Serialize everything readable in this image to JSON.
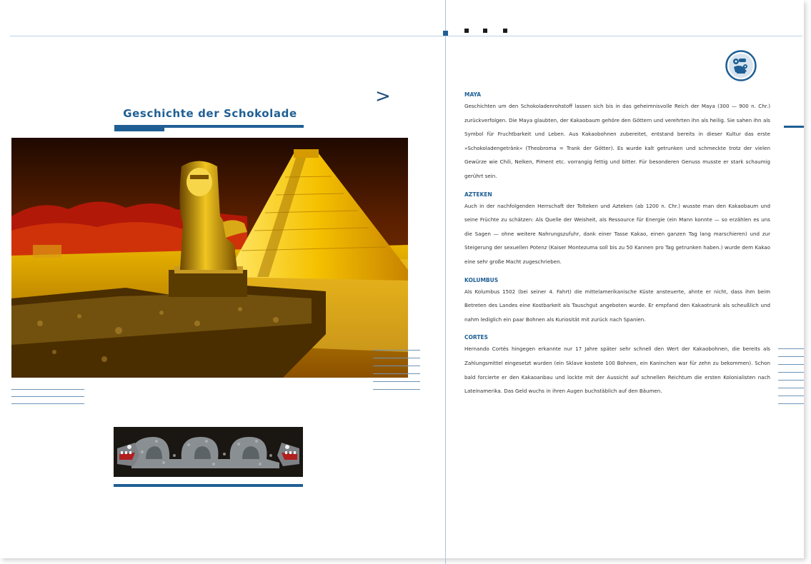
{
  "page": {
    "chevron": ">",
    "title": "Geschichte der Schokolade"
  },
  "sections": [
    {
      "heading": "MAYA",
      "body": "Geschichten um den Schokoladenrohstoff lassen sich bis in das geheimnisvolle Reich der Maya (300 — 900 n. Chr.) zurückverfolgen. Die Maya glaubten, der Kakaobaum gehöre den Göttern und verehrten ihn als heilig. Sie sahen ihn als Symbol für Fruchtbarkeit und Leben. Aus Kakaobohnen zubereitet, entstand bereits in dieser Kultur das erste »Schokoladengetränk« (Theobroma = Trank der Götter). Es wurde kalt getrunken und schmeckte trotz der vielen Gewürze wie Chili, Nelken, Piment etc. vorrangig fettig und bitter. Für besonderen Genuss musste er stark schaumig gerührt sein."
    },
    {
      "heading": "AZTEKEN",
      "body": "Auch in der nachfolgenden Herrschaft der Tolteken und Azteken (ab 1200 n. Chr.) wusste man den Kakaobaum und seine Früchte zu schätzen: Als Quelle der Weisheit, als Ressource für Energie (ein Mann konnte — so erzählen es uns die Sagen — ohne weitere Nahrungszufuhr, dank einer Tasse Kakao, einen ganzen Tag lang marschieren) und zur Steigerung der sexuellen Potenz (Kaiser Montezuma soll bis zu 50 Kannen pro Tag getrunken haben.) wurde dem Kakao eine sehr große Macht zugeschrieben."
    },
    {
      "heading": "KOLUMBUS",
      "body": "Als Kolumbus 1502 (bei seiner 4. Fahrt) die mittelamerikanische Küste ansteuerte, ahnte er nicht, dass ihm beim Betreten des Landes eine Kostbarkeit als Tauschgut angeboten wurde. Er empfand den Kakaotrunk als scheußlich und nahm lediglich ein paar Bohnen als Kuriosität mit zurück nach Spanien."
    },
    {
      "heading": "CORTES",
      "body": "Hernando Cortés hingegen erkannte nur 17 Jahre später sehr schnell den Wert der Kakaobohnen, die bereits als Zahlungsmittel eingesetzt wurden (ein Sklave kostete 100 Bohnen, ein Kaninchen war für zehn zu bekommen). Schon bald forcierte er den Kakaoanbau und lockte mit der Aussicht auf schnellen Reichtum die ersten Kolonialisten nach Lateinamerika. Das Geld wuchs in ihren Augen buchstäblich auf den Bäumen."
    }
  ],
  "colors": {
    "accent": "#1f5f94",
    "rule": "#6f93b6",
    "text": "#2f2f2f"
  },
  "icons": {
    "emblem": "maya-glyph-emblem-icon",
    "chevron": "chevron-right-icon"
  }
}
